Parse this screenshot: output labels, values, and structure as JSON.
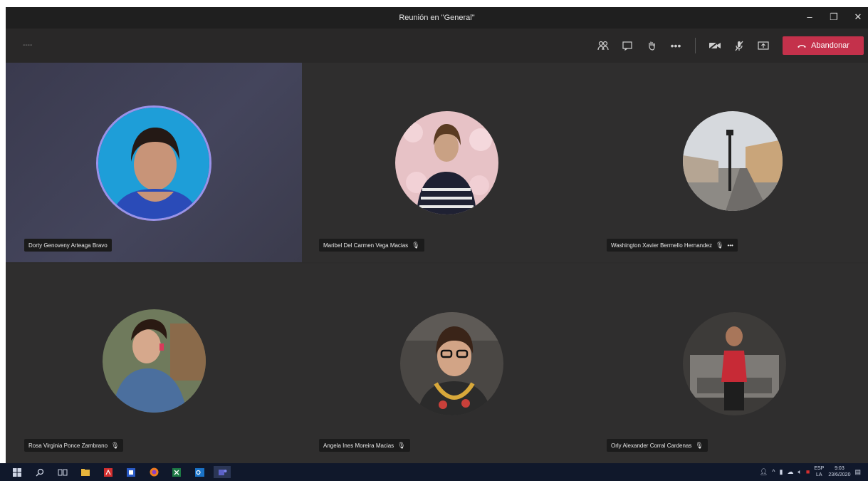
{
  "window": {
    "title": "Reunión en \"General\"",
    "minimize_icon": "minimize-icon",
    "restore_icon": "restore-icon",
    "close_icon": "close-icon"
  },
  "toolbar": {
    "timer": "----",
    "people_icon": "participants-icon",
    "chat_icon": "chat-icon",
    "hand_icon": "raise-hand-icon",
    "more_label": "•••",
    "camera_icon": "camera-off-icon",
    "mic_icon": "mic-off-icon",
    "share_icon": "share-screen-icon",
    "leave_label": "Abandonar",
    "leave_color": "#c4314b"
  },
  "participants": [
    {
      "name": "Dorty Genoveny Arteaga Bravo",
      "muted": false,
      "active": true
    },
    {
      "name": "Maribel Del Carmen Vega Macias",
      "muted": true,
      "active": false
    },
    {
      "name": "Washington Xavier Bermello Hernandez",
      "muted": true,
      "more": "•••",
      "active": false
    },
    {
      "name": "Rosa Virginia Ponce Zambrano",
      "muted": true,
      "active": false
    },
    {
      "name": "Angela Ines Moreira Macias",
      "muted": true,
      "active": false
    },
    {
      "name": "Orly Alexander Corral Cardenas",
      "muted": true,
      "active": false
    }
  ],
  "taskbar": {
    "apps": [
      "windows-start-icon",
      "search-icon",
      "task-view-icon",
      "file-explorer-icon",
      "acrobat-icon",
      "word-icon",
      "firefox-icon",
      "excel-icon",
      "outlook-icon",
      "teams-icon"
    ],
    "lang": "ESP",
    "lang_sub": "LA",
    "time": "9:03",
    "date": "23/6/2020"
  }
}
